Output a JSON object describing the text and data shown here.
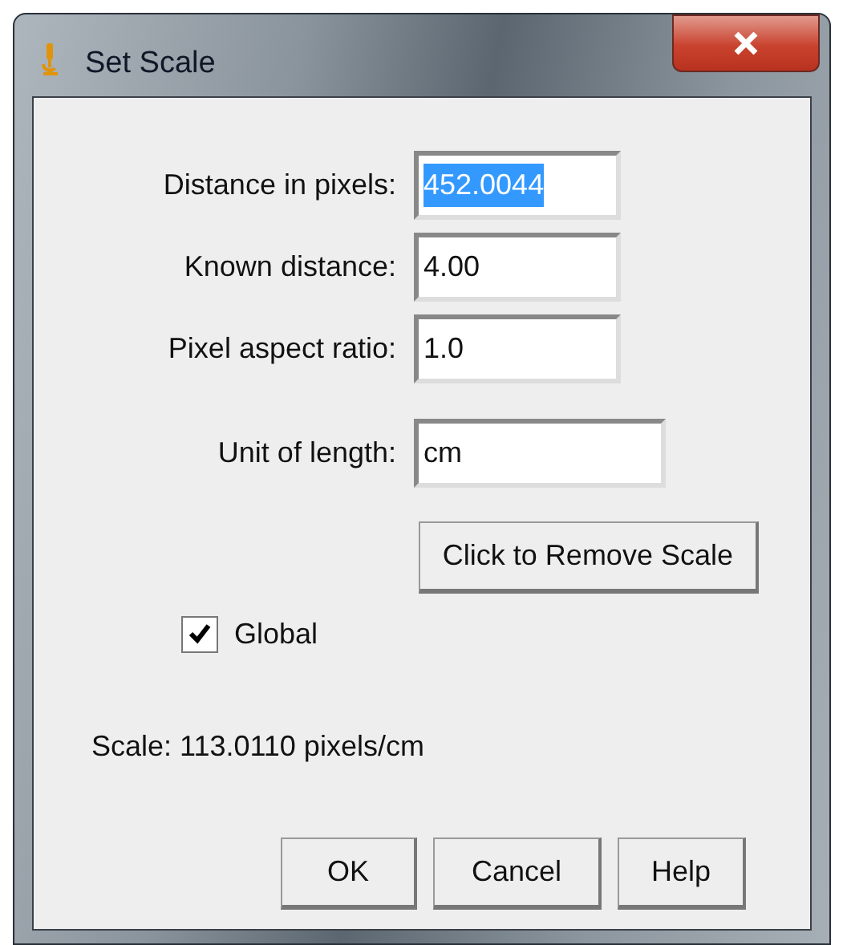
{
  "window": {
    "title": "Set Scale"
  },
  "fields": [
    {
      "label": "Distance in pixels:",
      "value": "452.0044",
      "text_selected": true,
      "wide": false
    },
    {
      "label": "Known distance:",
      "value": "4.00",
      "text_selected": false,
      "wide": false
    },
    {
      "label": "Pixel aspect ratio:",
      "value": "1.0",
      "text_selected": false,
      "wide": false
    },
    {
      "label": "Unit of length:",
      "value": "cm",
      "text_selected": false,
      "wide": true
    }
  ],
  "remove_button": "Click to Remove Scale",
  "global_checkbox": {
    "label": "Global",
    "checked": true
  },
  "scale_text": "Scale: 113.0110 pixels/cm",
  "buttons": [
    "OK",
    "Cancel",
    "Help"
  ]
}
